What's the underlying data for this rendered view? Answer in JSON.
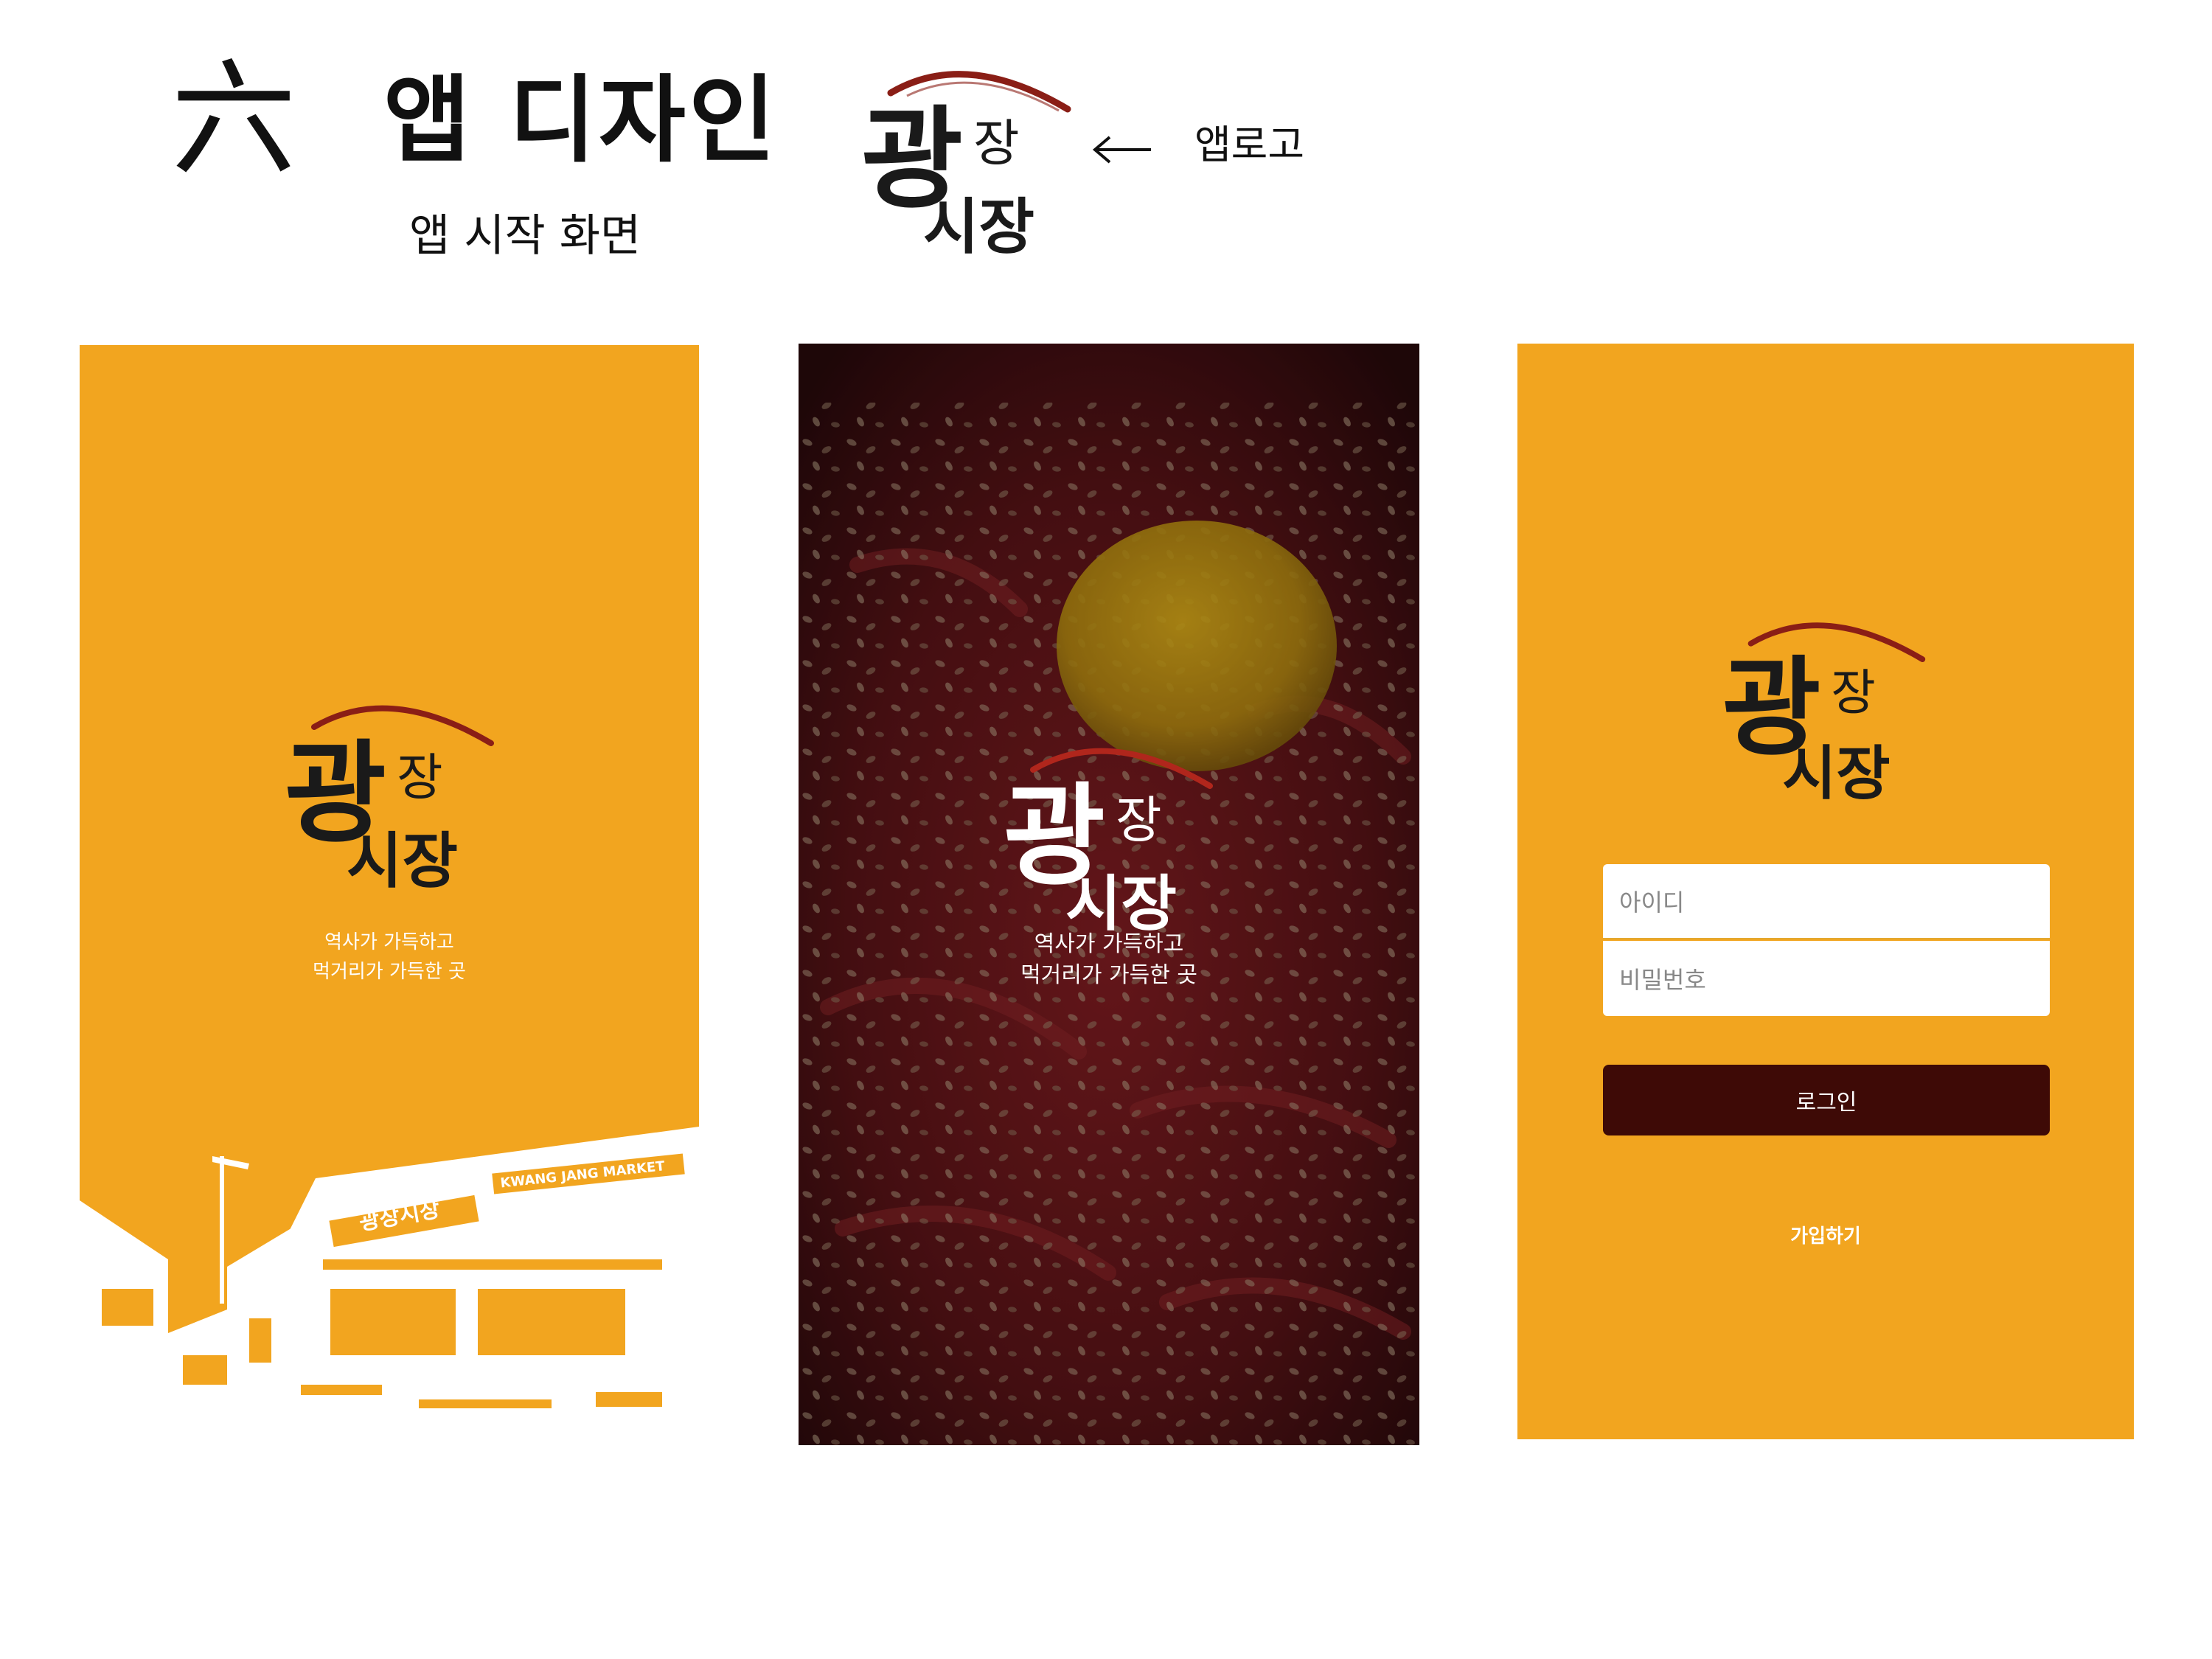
{
  "header": {
    "hanja": "六",
    "title": "앱 디자인",
    "subtitle": "앱 시작 화면",
    "logo_caption": "앱로고"
  },
  "brand": {
    "logo_text_main": "광",
    "logo_text_top": "장",
    "logo_text_bottom": "시장",
    "logo_arc_color": "#8a1e16",
    "accent_yellow": "#f2a51f",
    "button_brown": "#3e0a06"
  },
  "screens": [
    {
      "name": "splash-market",
      "tagline_line1": "역사가 가득하고",
      "tagline_line2": "먹거리가 가득한 곳",
      "building_sign_1": "광장시장",
      "building_sign_2": "KWANG JANG MARKET"
    },
    {
      "name": "splash-food",
      "tagline_line1": "역사가 가득하고",
      "tagline_line2": "먹거리가 가득한 곳"
    },
    {
      "name": "login",
      "id_placeholder": "아이디",
      "password_placeholder": "비밀번호",
      "login_label": "로그인",
      "signup_label": "가입하기"
    }
  ]
}
